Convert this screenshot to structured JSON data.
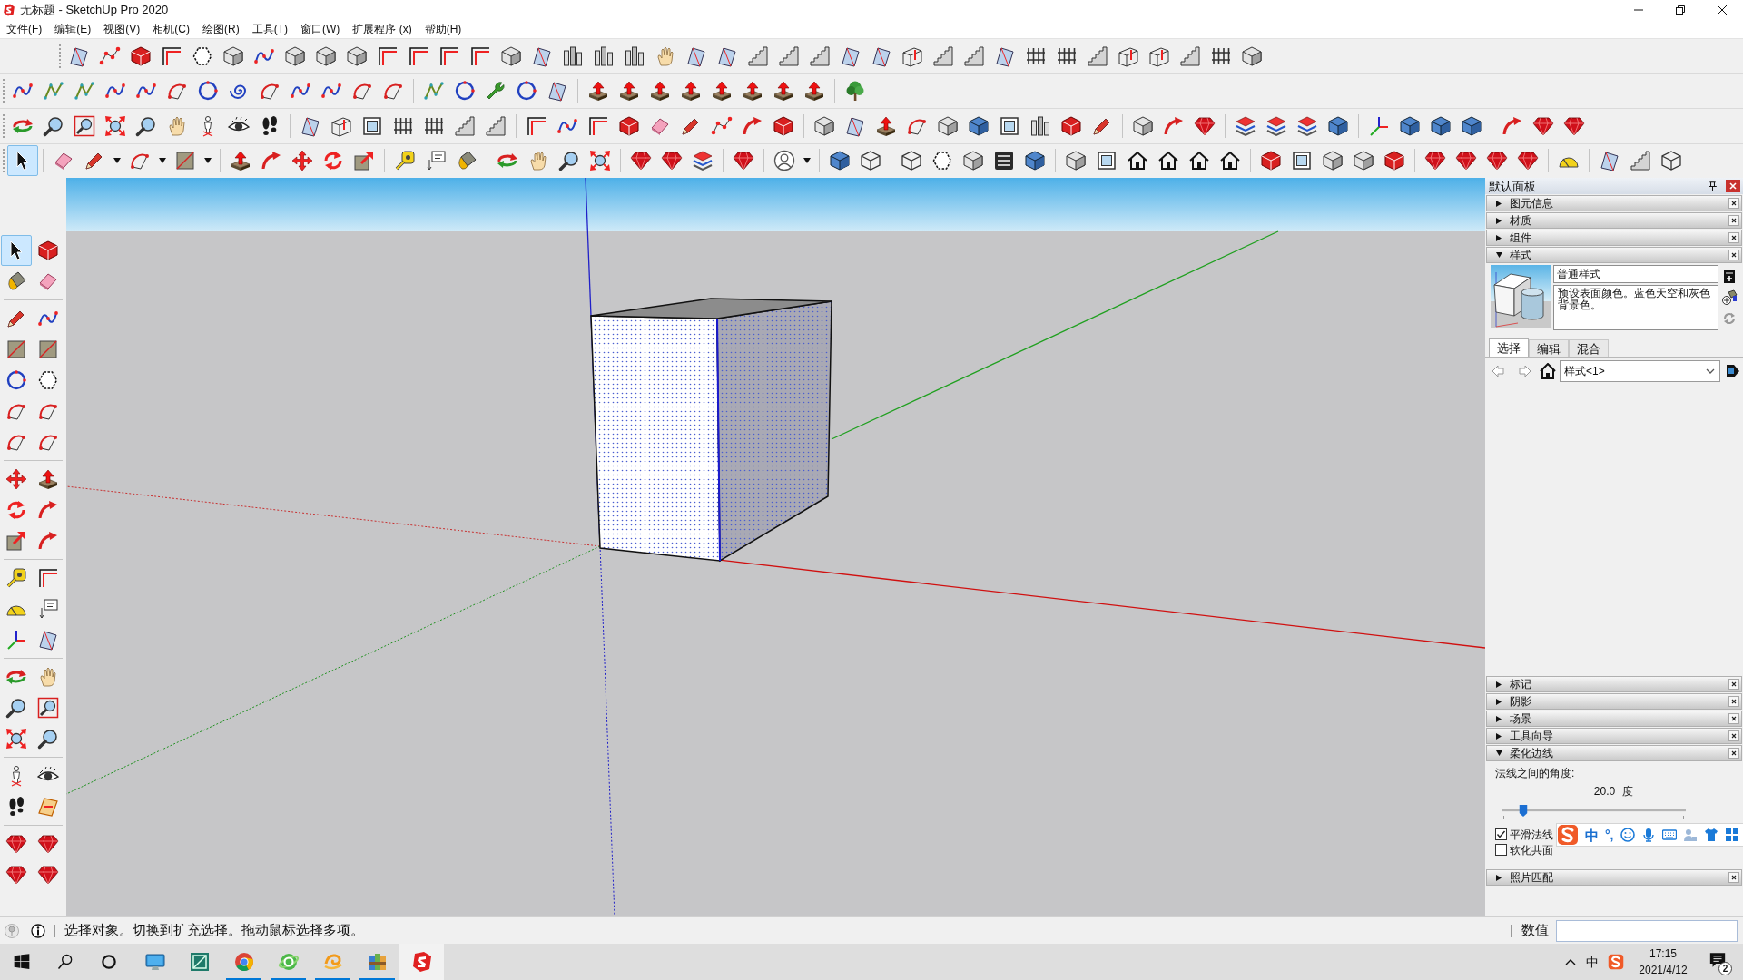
{
  "window": {
    "title": "无标题 - SketchUp Pro 2020"
  },
  "menu": [
    "文件(F)",
    "编辑(E)",
    "视图(V)",
    "相机(C)",
    "绘图(R)",
    "工具(T)",
    "窗口(W)",
    "扩展程序 (x)",
    "帮助(H)"
  ],
  "toolbars": [
    {
      "groups": [
        [
          {
            "kind": "plane",
            "selected": false
          },
          {
            "kind": "dots",
            "selected": false
          },
          {
            "kind": "solid",
            "selected": false
          },
          {
            "kind": "corner",
            "selected": false
          },
          {
            "kind": "hexagon",
            "selected": false
          },
          {
            "kind": "cube",
            "selected": false
          },
          {
            "kind": "curve",
            "selected": false
          },
          {
            "kind": "cube",
            "selected": false
          },
          {
            "kind": "cube",
            "selected": false
          },
          {
            "kind": "cube",
            "selected": false
          },
          {
            "kind": "corner",
            "selected": false
          },
          {
            "kind": "corner",
            "selected": false
          },
          {
            "kind": "corner",
            "selected": false
          },
          {
            "kind": "corner",
            "selected": false
          },
          {
            "kind": "cube",
            "selected": false
          },
          {
            "kind": "plane",
            "selected": false
          },
          {
            "kind": "columns",
            "selected": false
          },
          {
            "kind": "columns",
            "selected": false
          },
          {
            "kind": "columns",
            "selected": false
          },
          {
            "kind": "hand",
            "selected": false
          },
          {
            "kind": "plane",
            "selected": false
          },
          {
            "kind": "plane",
            "selected": false
          },
          {
            "kind": "stairs",
            "selected": false
          },
          {
            "kind": "stairs",
            "selected": false
          },
          {
            "kind": "stairs",
            "selected": false
          },
          {
            "kind": "plane",
            "selected": false
          },
          {
            "kind": "plane",
            "selected": false
          },
          {
            "kind": "wall",
            "selected": false
          },
          {
            "kind": "stairs",
            "selected": false
          },
          {
            "kind": "stairs",
            "selected": false
          },
          {
            "kind": "plane",
            "selected": false
          },
          {
            "kind": "fence",
            "selected": false
          },
          {
            "kind": "fence",
            "selected": false
          },
          {
            "kind": "stairs",
            "selected": false
          },
          {
            "kind": "wall",
            "selected": false
          },
          {
            "kind": "wall",
            "selected": false
          },
          {
            "kind": "stairs",
            "selected": false
          },
          {
            "kind": "fence",
            "selected": false
          },
          {
            "kind": "cube",
            "selected": false
          }
        ]
      ]
    },
    {
      "groups": [
        [
          {
            "kind": "curve",
            "selected": false
          },
          {
            "kind": "zigzag",
            "selected": false
          },
          {
            "kind": "zigzag",
            "selected": false
          },
          {
            "kind": "curve",
            "selected": false
          },
          {
            "kind": "curve",
            "selected": false
          },
          {
            "kind": "arc",
            "selected": false
          },
          {
            "kind": "circle",
            "selected": false
          },
          {
            "kind": "spiral",
            "selected": false
          },
          {
            "kind": "arc",
            "selected": false
          },
          {
            "kind": "curve",
            "selected": false
          },
          {
            "kind": "curve",
            "selected": false
          },
          {
            "kind": "arc",
            "selected": false
          },
          {
            "kind": "arc",
            "selected": false
          }
        ],
        [
          {
            "kind": "zigzag",
            "selected": false
          },
          {
            "kind": "circle",
            "selected": false
          },
          {
            "kind": "wrench",
            "selected": false
          },
          {
            "kind": "circle",
            "selected": false
          },
          {
            "kind": "plane",
            "selected": false
          }
        ],
        [
          {
            "kind": "pushpull",
            "selected": false
          },
          {
            "kind": "pushpull",
            "selected": false
          },
          {
            "kind": "pushpull",
            "selected": false
          },
          {
            "kind": "pushpull",
            "selected": false
          },
          {
            "kind": "pushpull",
            "selected": false
          },
          {
            "kind": "pushpull",
            "selected": false
          },
          {
            "kind": "pushpull",
            "selected": false
          },
          {
            "kind": "pushpull",
            "selected": false
          }
        ],
        [
          {
            "kind": "tree",
            "selected": false
          }
        ]
      ]
    },
    {
      "groups": [
        [
          {
            "kind": "orbit",
            "selected": false
          },
          {
            "kind": "zoom",
            "selected": false
          },
          {
            "kind": "zoomwin",
            "selected": false
          },
          {
            "kind": "zoomext",
            "selected": false
          },
          {
            "kind": "zoom",
            "selected": false
          },
          {
            "kind": "hand",
            "selected": false
          },
          {
            "kind": "person",
            "selected": false
          },
          {
            "kind": "eye",
            "selected": false
          },
          {
            "kind": "walk",
            "selected": false
          }
        ],
        [
          {
            "kind": "plane",
            "selected": false
          },
          {
            "kind": "wall",
            "selected": false
          },
          {
            "kind": "window",
            "selected": false
          },
          {
            "kind": "fence",
            "selected": false
          },
          {
            "kind": "fence",
            "selected": false
          },
          {
            "kind": "stairs",
            "selected": false
          },
          {
            "kind": "stairs",
            "selected": false
          }
        ],
        [
          {
            "kind": "corner",
            "selected": false
          },
          {
            "kind": "curve",
            "selected": false
          },
          {
            "kind": "corner",
            "selected": false
          },
          {
            "kind": "solid",
            "selected": false
          },
          {
            "kind": "eraser",
            "selected": false
          },
          {
            "kind": "pencil",
            "selected": false
          },
          {
            "kind": "dots",
            "selected": false
          },
          {
            "kind": "followme",
            "selected": false
          },
          {
            "kind": "solid",
            "selected": false
          }
        ],
        [
          {
            "kind": "cube",
            "selected": false
          },
          {
            "kind": "plane",
            "selected": false
          },
          {
            "kind": "pushpull",
            "selected": false
          },
          {
            "kind": "arc",
            "selected": false
          },
          {
            "kind": "cube",
            "selected": false
          },
          {
            "kind": "shade",
            "selected": false
          },
          {
            "kind": "window",
            "selected": false
          },
          {
            "kind": "columns",
            "selected": false
          },
          {
            "kind": "solid",
            "selected": false
          },
          {
            "kind": "pencil",
            "selected": false
          }
        ],
        [
          {
            "kind": "cube",
            "selected": false
          },
          {
            "kind": "followme",
            "selected": false
          },
          {
            "kind": "gem",
            "selected": false
          }
        ],
        [
          {
            "kind": "layers",
            "selected": false
          },
          {
            "kind": "layers",
            "selected": false
          },
          {
            "kind": "layers",
            "selected": false
          },
          {
            "kind": "shade",
            "selected": false
          }
        ],
        [
          {
            "kind": "axes",
            "selected": false
          },
          {
            "kind": "shade",
            "selected": false
          },
          {
            "kind": "shade",
            "selected": false
          },
          {
            "kind": "shade",
            "selected": false
          }
        ],
        [
          {
            "kind": "followme",
            "selected": false
          },
          {
            "kind": "gem",
            "selected": false
          },
          {
            "kind": "gem",
            "selected": false
          }
        ]
      ]
    },
    {
      "groups": [
        [
          {
            "kind": "cursor",
            "selected": true
          }
        ],
        [
          {
            "kind": "eraser",
            "selected": false
          },
          {
            "kind": "pencil",
            "selected": false
          },
          {
            "kind": "caret",
            "selected": false
          },
          {
            "kind": "arc",
            "selected": false
          },
          {
            "kind": "caret",
            "selected": false
          },
          {
            "kind": "rect",
            "selected": false
          },
          {
            "kind": "caret",
            "selected": false
          }
        ],
        [
          {
            "kind": "pushpull",
            "selected": false
          },
          {
            "kind": "followme",
            "selected": false
          },
          {
            "kind": "move",
            "selected": false
          },
          {
            "kind": "rotate",
            "selected": false
          },
          {
            "kind": "scale",
            "selected": false
          }
        ],
        [
          {
            "kind": "tape",
            "selected": false
          },
          {
            "kind": "label",
            "selected": false
          },
          {
            "kind": "bucket",
            "selected": false
          }
        ],
        [
          {
            "kind": "orbit",
            "selected": false
          },
          {
            "kind": "hand",
            "selected": false
          },
          {
            "kind": "zoom",
            "selected": false
          },
          {
            "kind": "zoomext",
            "selected": false
          }
        ],
        [
          {
            "kind": "gem",
            "selected": false
          },
          {
            "kind": "gem",
            "selected": false
          },
          {
            "kind": "layers",
            "selected": false
          }
        ],
        [
          {
            "kind": "gem",
            "selected": false
          }
        ],
        [
          {
            "kind": "user",
            "selected": false
          },
          {
            "kind": "caret",
            "selected": false
          }
        ],
        [
          {
            "kind": "shade",
            "selected": false
          },
          {
            "kind": "outline",
            "selected": false
          }
        ],
        [
          {
            "kind": "outline",
            "selected": false
          },
          {
            "kind": "hexagon",
            "selected": false
          },
          {
            "kind": "cube",
            "selected": false
          },
          {
            "kind": "stripes",
            "selected": false
          },
          {
            "kind": "shade",
            "selected": false
          }
        ],
        [
          {
            "kind": "cube",
            "selected": false
          },
          {
            "kind": "window",
            "selected": false
          },
          {
            "kind": "house",
            "selected": false
          },
          {
            "kind": "house",
            "selected": false
          },
          {
            "kind": "house",
            "selected": false
          },
          {
            "kind": "house",
            "selected": false
          }
        ],
        [
          {
            "kind": "solid",
            "selected": false
          },
          {
            "kind": "window",
            "selected": false
          },
          {
            "kind": "cube",
            "selected": false
          },
          {
            "kind": "cube",
            "selected": false
          },
          {
            "kind": "solid",
            "selected": false
          }
        ],
        [
          {
            "kind": "gem",
            "selected": false
          },
          {
            "kind": "gem",
            "selected": false
          },
          {
            "kind": "gem",
            "selected": false
          },
          {
            "kind": "gem",
            "selected": false
          }
        ],
        [
          {
            "kind": "protractor",
            "selected": false
          }
        ],
        [
          {
            "kind": "plane",
            "selected": false
          },
          {
            "kind": "stairs",
            "selected": false
          },
          {
            "kind": "outline",
            "selected": false
          }
        ]
      ]
    }
  ],
  "left_toolbar": {
    "groups": [
      [
        {
          "kind": "cursor",
          "selected": true
        },
        {
          "kind": "solid",
          "selected": false
        },
        {
          "kind": "bucket",
          "selected": false
        },
        {
          "kind": "eraser",
          "selected": false
        }
      ],
      [
        {
          "kind": "pencil",
          "selected": false
        },
        {
          "kind": "curve",
          "selected": false
        },
        {
          "kind": "rect",
          "selected": false
        },
        {
          "kind": "rect",
          "selected": false
        },
        {
          "kind": "circle",
          "selected": false
        },
        {
          "kind": "hexagon",
          "selected": false
        },
        {
          "kind": "arc",
          "selected": false
        },
        {
          "kind": "arc",
          "selected": false
        },
        {
          "kind": "arc",
          "selected": false
        },
        {
          "kind": "arc",
          "selected": false
        }
      ],
      [
        {
          "kind": "move",
          "selected": false
        },
        {
          "kind": "pushpull",
          "selected": false
        },
        {
          "kind": "rotate",
          "selected": false
        },
        {
          "kind": "followme",
          "selected": false
        },
        {
          "kind": "scale",
          "selected": false
        },
        {
          "kind": "followme",
          "selected": false
        }
      ],
      [
        {
          "kind": "tape",
          "selected": false
        },
        {
          "kind": "corner",
          "selected": false
        },
        {
          "kind": "protractor",
          "selected": false
        },
        {
          "kind": "label",
          "selected": false
        },
        {
          "kind": "axes",
          "selected": false
        },
        {
          "kind": "plane",
          "selected": false
        }
      ],
      [
        {
          "kind": "orbit",
          "selected": false
        },
        {
          "kind": "hand",
          "selected": false
        },
        {
          "kind": "zoom",
          "selected": false
        },
        {
          "kind": "zoomwin",
          "selected": false
        },
        {
          "kind": "zoomext",
          "selected": false
        },
        {
          "kind": "zoom",
          "selected": false
        }
      ],
      [
        {
          "kind": "person",
          "selected": false
        },
        {
          "kind": "eye",
          "selected": false
        },
        {
          "kind": "walk",
          "selected": false
        },
        {
          "kind": "section",
          "selected": false
        }
      ],
      [
        {
          "kind": "gem",
          "selected": false
        },
        {
          "kind": "gem",
          "selected": false
        },
        {
          "kind": "gem",
          "selected": false
        },
        {
          "kind": "gem",
          "selected": false
        }
      ]
    ]
  },
  "tray": {
    "title": "默认面板",
    "sections": [
      {
        "label": "图元信息",
        "expanded": false
      },
      {
        "label": "材质",
        "expanded": false
      },
      {
        "label": "组件",
        "expanded": false
      },
      {
        "label": "样式",
        "expanded": true,
        "style_name": "普通样式",
        "description": "预设表面颜色。蓝色天空和灰色背景色。",
        "tabs": [
          {
            "label": "选择",
            "selected": true
          },
          {
            "label": "编辑",
            "selected": false
          },
          {
            "label": "混合",
            "selected": false
          }
        ],
        "collection": "样式<1>"
      },
      {
        "label": "标记",
        "expanded": false
      },
      {
        "label": "阴影",
        "expanded": false
      },
      {
        "label": "场景",
        "expanded": false
      },
      {
        "label": "工具向导",
        "expanded": false
      },
      {
        "label": "柔化边线",
        "expanded": true,
        "angle_label": "法线之间的角度:",
        "angle_value": "20.0",
        "angle_unit": "度",
        "level": 0.12,
        "options": [
          {
            "label": "平滑法线",
            "checked": true
          },
          {
            "label": "软化共面",
            "checked": false
          }
        ]
      },
      {
        "label": "照片匹配",
        "expanded": false
      }
    ]
  },
  "ime_toolbar": {
    "mode": "中",
    "punctuation": "°,"
  },
  "status_bar": {
    "hint": "选择对象。切换到扩充选择。拖动鼠标选择多项。",
    "measurement_label": "数值"
  },
  "taskbar": {
    "apps": [
      {
        "kind": "monitor",
        "open": false,
        "active": false
      },
      {
        "kind": "tile",
        "open": false,
        "active": false
      },
      {
        "kind": "browser",
        "open": true,
        "active": false
      },
      {
        "kind": "globe",
        "open": true,
        "active": false
      },
      {
        "kind": "swirl",
        "open": true,
        "active": false
      },
      {
        "kind": "archive",
        "open": true,
        "active": false
      },
      {
        "kind": "logo",
        "open": false,
        "active": true
      }
    ],
    "ime": "中",
    "time": "17:15",
    "date": "2021/4/12",
    "notifications": "2"
  }
}
